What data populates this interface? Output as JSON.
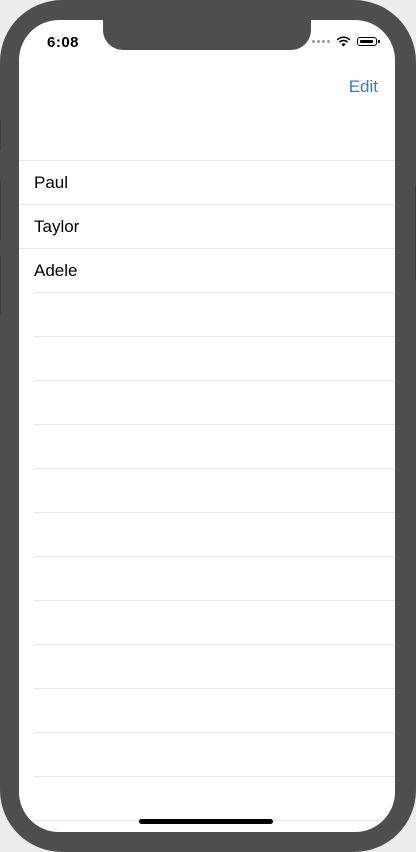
{
  "status_bar": {
    "time": "6:08",
    "icons": [
      "cellular-signal-icon",
      "wifi-icon",
      "battery-icon"
    ]
  },
  "nav_bar": {
    "edit_label": "Edit"
  },
  "list": {
    "items": [
      {
        "label": "Paul"
      },
      {
        "label": "Taylor"
      },
      {
        "label": "Adele"
      }
    ]
  },
  "colors": {
    "accent": "#2f7fcf",
    "separator": "#e6e6e6",
    "device_frame": "#4e4e4e"
  }
}
